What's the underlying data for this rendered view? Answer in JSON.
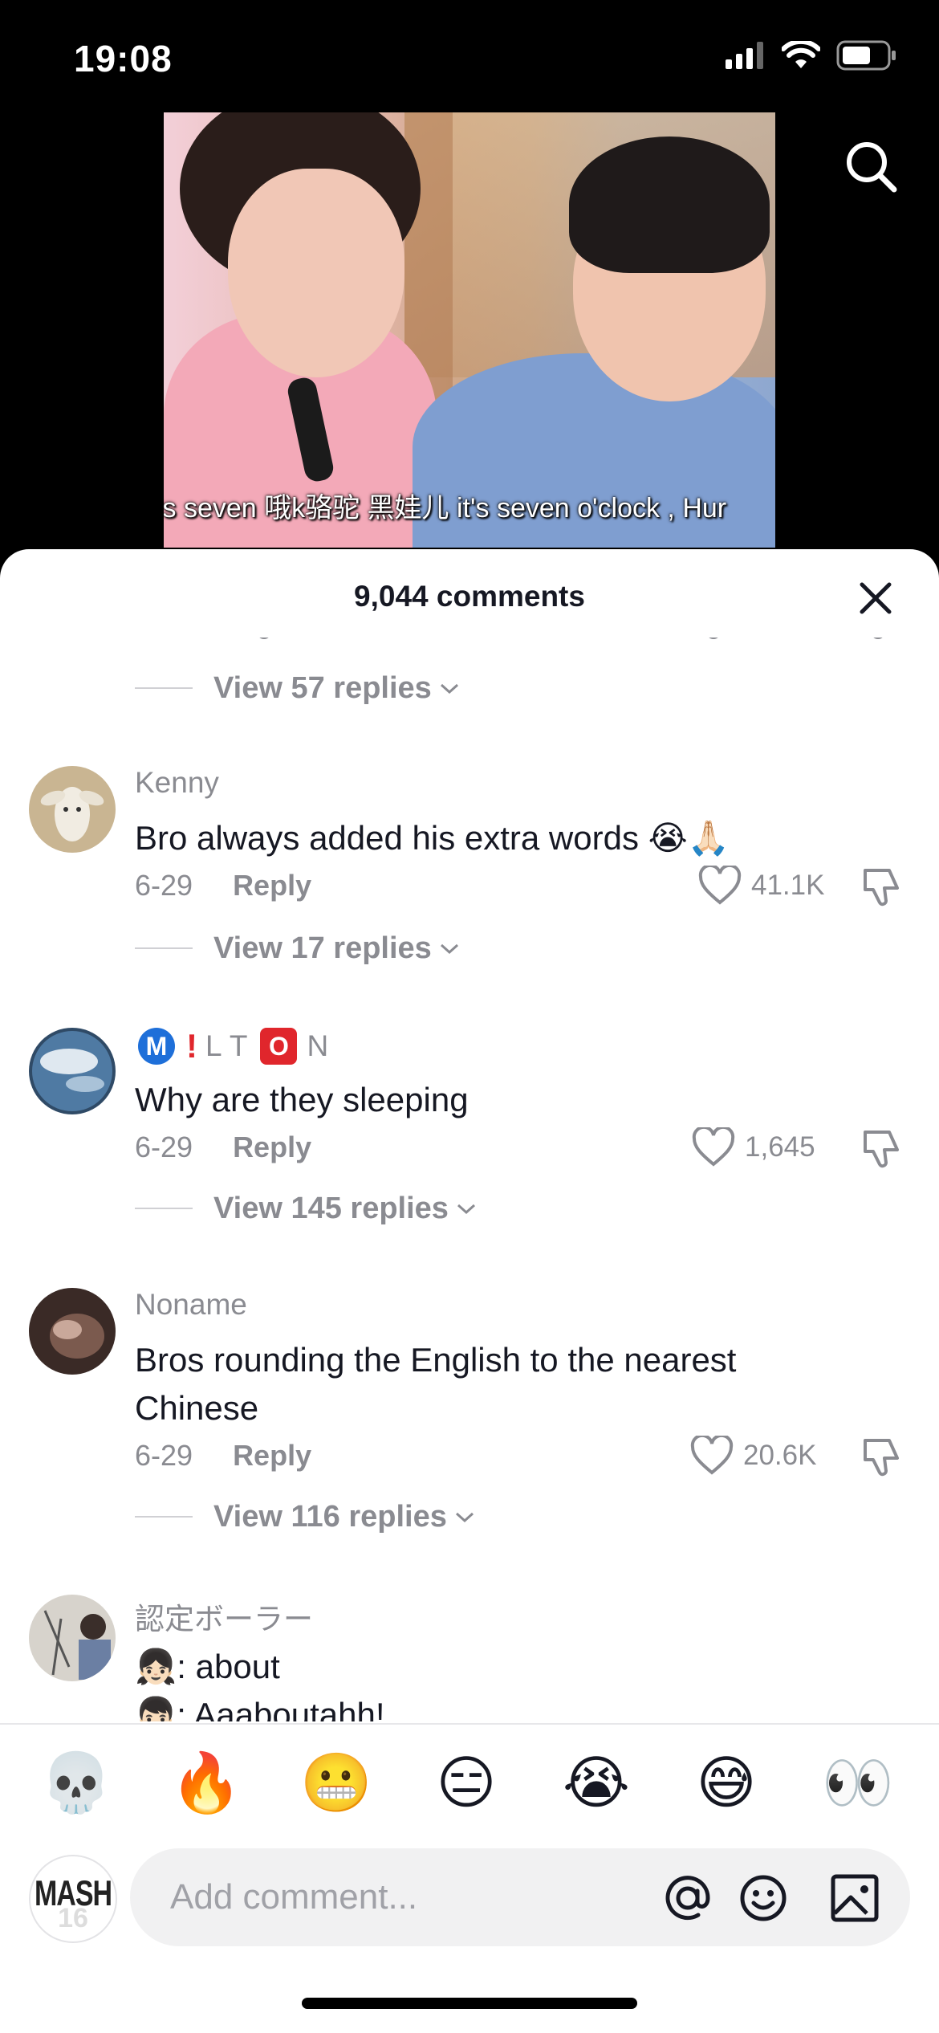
{
  "status_bar": {
    "time": "19:08"
  },
  "video": {
    "subtitle": "'s seven 哦k骆驼  黑娃儿  it's seven o'clock , Hur"
  },
  "comments_sheet": {
    "title": "9,044 comments",
    "comments": [
      {
        "username": "Kenny",
        "text": "Bro always added his extra words 😭🙏🏻",
        "date": "6-29",
        "reply_label": "Reply",
        "likes": "41.1K"
      },
      {
        "username_parts": [
          "M",
          "!",
          "LT",
          "O",
          "N"
        ],
        "text": "Why are they sleeping",
        "date": "6-29",
        "reply_label": "Reply",
        "likes": "1,645"
      },
      {
        "username": "Noname",
        "text": "Bros rounding the English to the nearest Chinese",
        "date": "6-29",
        "reply_label": "Reply",
        "likes": "20.6K"
      },
      {
        "username": "認定ボーラー",
        "text_lines": [
          "👧🏻: about",
          "👦🏻: Aaaboutahh!"
        ]
      }
    ],
    "view_replies": [
      "View 57 replies",
      "View 17 replies",
      "View 145 replies",
      "View 116 replies"
    ]
  },
  "emoji_bar": [
    "💀",
    "🔥",
    "😬",
    "😑",
    "😭",
    "😅",
    "👀"
  ],
  "composer": {
    "avatar_text": "MASH",
    "avatar_number": "16",
    "placeholder": "Add comment..."
  },
  "colors": {
    "secondary_text": "#8a8b91",
    "primary_text": "#161823",
    "input_bg": "#f1f1f2"
  }
}
